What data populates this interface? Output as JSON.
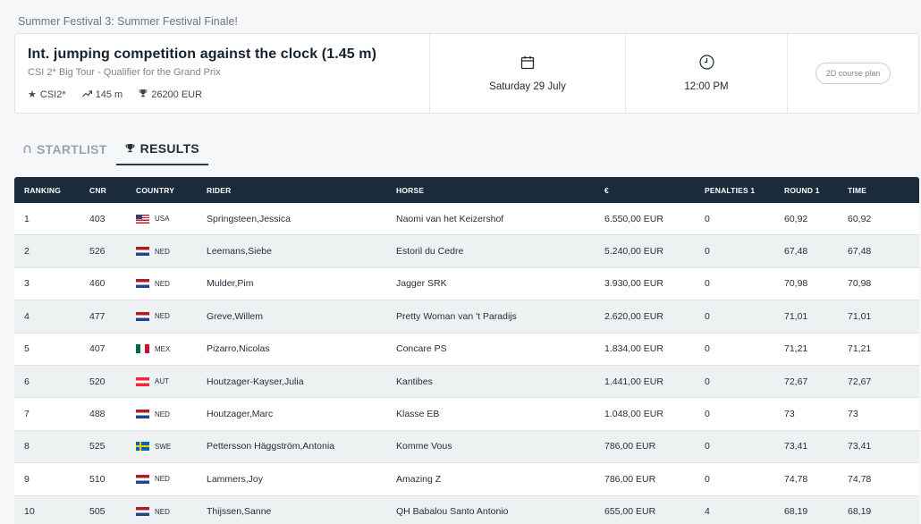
{
  "event": {
    "title": "Summer Festival 3: Summer Festival Finale!"
  },
  "competition": {
    "title": "Int. jumping competition against the clock (1.45 m)",
    "subtitle": "CSI 2* Big Tour - Qualifier for the Grand Prix",
    "level": "CSI2*",
    "height": "145 m",
    "prize": "26200 EUR",
    "date": "Saturday 29 July",
    "time": "12:00 PM",
    "course_plan_label": "2D course plan"
  },
  "tabs": {
    "startlist": "STARTLIST",
    "results": "RESULTS",
    "active": "results"
  },
  "table": {
    "headers": {
      "ranking": "RANKING",
      "cnr": "CNR",
      "country": "COUNTRY",
      "rider": "RIDER",
      "horse": "HORSE",
      "euro": "€",
      "penalties": "PENALTIES 1",
      "round1": "ROUND 1",
      "time": "TIME"
    },
    "rows": [
      {
        "rank": "1",
        "cnr": "403",
        "flag": "usa",
        "country": "USA",
        "rider": "Springsteen,Jessica",
        "horse": "Naomi van het Keizershof",
        "prize": "6.550,00 EUR",
        "penalties": "0",
        "round1": "60,92",
        "time": "60,92"
      },
      {
        "rank": "2",
        "cnr": "526",
        "flag": "ned",
        "country": "NED",
        "rider": "Leemans,Siebe",
        "horse": "Estoril du Cedre",
        "prize": "5.240,00 EUR",
        "penalties": "0",
        "round1": "67,48",
        "time": "67,48"
      },
      {
        "rank": "3",
        "cnr": "460",
        "flag": "ned",
        "country": "NED",
        "rider": "Mulder,Pim",
        "horse": "Jagger SRK",
        "prize": "3.930,00 EUR",
        "penalties": "0",
        "round1": "70,98",
        "time": "70,98"
      },
      {
        "rank": "4",
        "cnr": "477",
        "flag": "ned",
        "country": "NED",
        "rider": "Greve,Willem",
        "horse": "Pretty Woman van 't Paradijs",
        "prize": "2.620,00 EUR",
        "penalties": "0",
        "round1": "71,01",
        "time": "71,01"
      },
      {
        "rank": "5",
        "cnr": "407",
        "flag": "mex",
        "country": "MEX",
        "rider": "Pizarro,Nicolas",
        "horse": "Concare PS",
        "prize": "1.834,00 EUR",
        "penalties": "0",
        "round1": "71,21",
        "time": "71,21"
      },
      {
        "rank": "6",
        "cnr": "520",
        "flag": "aut",
        "country": "AUT",
        "rider": "Houtzager-Kayser,Julia",
        "horse": "Kantibes",
        "prize": "1.441,00 EUR",
        "penalties": "0",
        "round1": "72,67",
        "time": "72,67"
      },
      {
        "rank": "7",
        "cnr": "488",
        "flag": "ned",
        "country": "NED",
        "rider": "Houtzager,Marc",
        "horse": "Klasse EB",
        "prize": "1.048,00 EUR",
        "penalties": "0",
        "round1": "73",
        "time": "73"
      },
      {
        "rank": "8",
        "cnr": "525",
        "flag": "swe",
        "country": "SWE",
        "rider": "Pettersson Häggström,Antonia",
        "horse": "Komme Vous",
        "prize": "786,00 EUR",
        "penalties": "0",
        "round1": "73,41",
        "time": "73,41"
      },
      {
        "rank": "9",
        "cnr": "510",
        "flag": "ned",
        "country": "NED",
        "rider": "Lammers,Joy",
        "horse": "Amazing Z",
        "prize": "786,00 EUR",
        "penalties": "0",
        "round1": "74,78",
        "time": "74,78"
      },
      {
        "rank": "10",
        "cnr": "505",
        "flag": "ned",
        "country": "NED",
        "rider": "Thijssen,Sanne",
        "horse": "QH Babalou Santo Antonio",
        "prize": "655,00 EUR",
        "penalties": "4",
        "round1": "68,19",
        "time": "68,19"
      }
    ]
  },
  "colors": {
    "header_bg": "#1a2b3b",
    "row_alt": "#edf1f2",
    "accent": "#1f2d3a"
  }
}
